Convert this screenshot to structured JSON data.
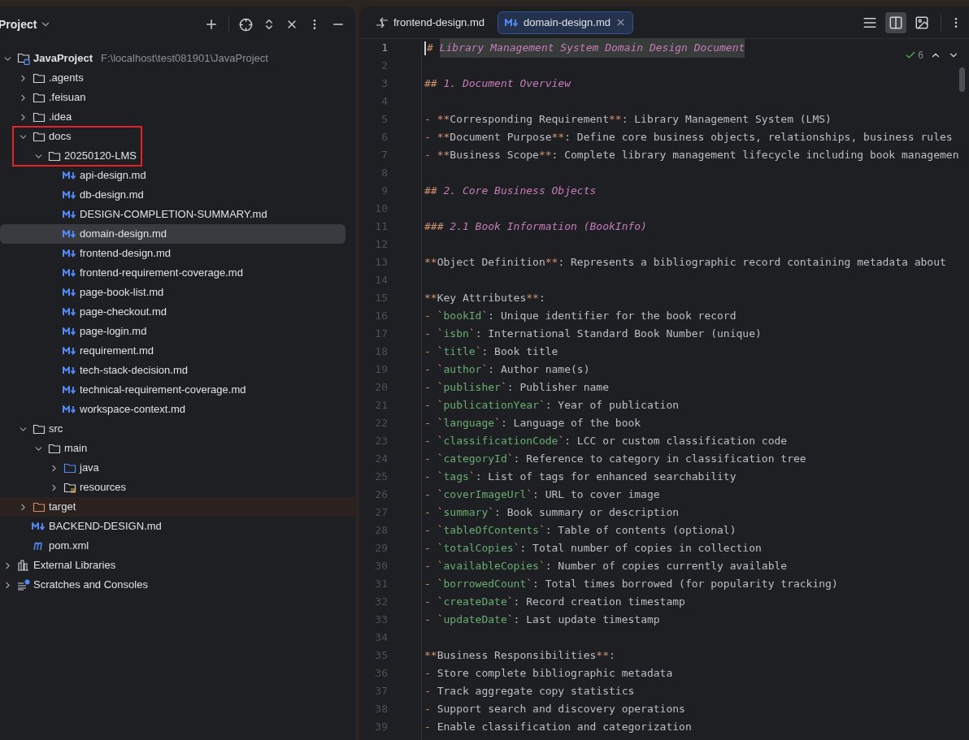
{
  "project_panel": {
    "title": "Project",
    "tree": [
      {
        "name": "JavaProject",
        "kind": "module",
        "location": "F:\\localhost\\test081901\\JavaProject",
        "expanded": true,
        "selected": false,
        "outlined": false,
        "children": [
          {
            "name": ".agents",
            "kind": "folder",
            "expanded": false,
            "selected": false,
            "outlined": false
          },
          {
            "name": ".feisuan",
            "kind": "folder",
            "expanded": false,
            "selected": false,
            "outlined": false
          },
          {
            "name": ".idea",
            "kind": "folder",
            "expanded": false,
            "selected": false,
            "outlined": false
          },
          {
            "name": "docs",
            "kind": "folder",
            "expanded": true,
            "selected": false,
            "outlined": true,
            "children": [
              {
                "name": "20250120-LMS",
                "kind": "folder",
                "expanded": true,
                "selected": false,
                "outlined": true,
                "children": [
                  {
                    "name": "api-design.md",
                    "kind": "markdown",
                    "selected": false,
                    "outlined": false
                  },
                  {
                    "name": "db-design.md",
                    "kind": "markdown",
                    "selected": false,
                    "outlined": false
                  },
                  {
                    "name": "DESIGN-COMPLETION-SUMMARY.md",
                    "kind": "markdown",
                    "selected": false,
                    "outlined": false
                  },
                  {
                    "name": "domain-design.md",
                    "kind": "markdown",
                    "selected": true,
                    "outlined": false
                  },
                  {
                    "name": "frontend-design.md",
                    "kind": "markdown",
                    "selected": false,
                    "outlined": false
                  },
                  {
                    "name": "frontend-requirement-coverage.md",
                    "kind": "markdown",
                    "selected": false,
                    "outlined": false
                  },
                  {
                    "name": "page-book-list.md",
                    "kind": "markdown",
                    "selected": false,
                    "outlined": false
                  },
                  {
                    "name": "page-checkout.md",
                    "kind": "markdown",
                    "selected": false,
                    "outlined": false
                  },
                  {
                    "name": "page-login.md",
                    "kind": "markdown",
                    "selected": false,
                    "outlined": false
                  },
                  {
                    "name": "requirement.md",
                    "kind": "markdown",
                    "selected": false,
                    "outlined": false
                  },
                  {
                    "name": "tech-stack-decision.md",
                    "kind": "markdown",
                    "selected": false,
                    "outlined": false
                  },
                  {
                    "name": "technical-requirement-coverage.md",
                    "kind": "markdown",
                    "selected": false,
                    "outlined": false
                  },
                  {
                    "name": "workspace-context.md",
                    "kind": "markdown",
                    "selected": false,
                    "outlined": false
                  }
                ]
              }
            ]
          },
          {
            "name": "src",
            "kind": "folder",
            "expanded": true,
            "selected": false,
            "outlined": false,
            "children": [
              {
                "name": "main",
                "kind": "folder",
                "expanded": true,
                "selected": false,
                "outlined": false,
                "children": [
                  {
                    "name": "java",
                    "kind": "source-folder",
                    "expanded": false,
                    "selected": false,
                    "outlined": false
                  },
                  {
                    "name": "resources",
                    "kind": "resources-folder",
                    "expanded": false,
                    "selected": false,
                    "outlined": false
                  }
                ]
              }
            ]
          },
          {
            "name": "target",
            "kind": "excluded-folder",
            "expanded": false,
            "selected": false,
            "outlined": false
          },
          {
            "name": "BACKEND-DESIGN.md",
            "kind": "markdown",
            "selected": false,
            "outlined": false
          },
          {
            "name": "pom.xml",
            "kind": "maven",
            "selected": false,
            "outlined": false
          }
        ]
      },
      {
        "name": "External Libraries",
        "kind": "libraries",
        "expanded": false,
        "selected": false,
        "outlined": false
      },
      {
        "name": "Scratches and Consoles",
        "kind": "scratches",
        "expanded": false,
        "selected": false,
        "outlined": false
      }
    ]
  },
  "editor": {
    "tabs": [
      {
        "label": "frontend-design.md",
        "kind": "diff",
        "selected": false
      },
      {
        "label": "domain-design.md",
        "kind": "markdown",
        "selected": true
      }
    ],
    "view_modes": [
      {
        "kind": "editor",
        "selected": false
      },
      {
        "kind": "split",
        "selected": true
      },
      {
        "kind": "preview",
        "selected": false
      }
    ],
    "problems_count": "6",
    "lines": [
      {
        "number": "1",
        "current": true,
        "segments": [
          {
            "kind": "mark",
            "text": "# "
          },
          {
            "kind": "heading",
            "text": "Library Management System Domain Design Document"
          }
        ]
      },
      {
        "number": "2",
        "current": false
      },
      {
        "number": "3",
        "current": false,
        "segments": [
          {
            "kind": "mark",
            "text": "## "
          },
          {
            "kind": "heading",
            "text": "1. Document Overview"
          }
        ]
      },
      {
        "number": "4",
        "current": false
      },
      {
        "number": "5",
        "current": false,
        "segments": [
          {
            "kind": "mark",
            "text": "- **"
          },
          {
            "kind": "text",
            "text": "Corresponding Requirement"
          },
          {
            "kind": "mark",
            "text": "**"
          },
          {
            "kind": "text",
            "text": ": Library Management System (LMS)"
          }
        ]
      },
      {
        "number": "6",
        "current": false,
        "segments": [
          {
            "kind": "mark",
            "text": "- **"
          },
          {
            "kind": "text",
            "text": "Document Purpose"
          },
          {
            "kind": "mark",
            "text": "**"
          },
          {
            "kind": "text",
            "text": ": Define core business objects, relationships, business rules"
          }
        ]
      },
      {
        "number": "7",
        "current": false,
        "segments": [
          {
            "kind": "mark",
            "text": "- **"
          },
          {
            "kind": "text",
            "text": "Business Scope"
          },
          {
            "kind": "mark",
            "text": "**"
          },
          {
            "kind": "text",
            "text": ": Complete library management lifecycle including book managemen"
          }
        ]
      },
      {
        "number": "8",
        "current": false
      },
      {
        "number": "9",
        "current": false,
        "segments": [
          {
            "kind": "mark",
            "text": "## "
          },
          {
            "kind": "heading",
            "text": "2. Core Business Objects"
          }
        ]
      },
      {
        "number": "10",
        "current": false
      },
      {
        "number": "11",
        "current": false,
        "segments": [
          {
            "kind": "mark",
            "text": "### "
          },
          {
            "kind": "heading",
            "text": "2.1 Book Information (BookInfo)"
          }
        ]
      },
      {
        "number": "12",
        "current": false
      },
      {
        "number": "13",
        "current": false,
        "segments": [
          {
            "kind": "mark",
            "text": "**"
          },
          {
            "kind": "text",
            "text": "Object Definition"
          },
          {
            "kind": "mark",
            "text": "**"
          },
          {
            "kind": "text",
            "text": ": Represents a bibliographic record containing metadata about"
          }
        ]
      },
      {
        "number": "14",
        "current": false
      },
      {
        "number": "15",
        "current": false,
        "segments": [
          {
            "kind": "mark",
            "text": "**"
          },
          {
            "kind": "text",
            "text": "Key Attributes"
          },
          {
            "kind": "mark",
            "text": "**"
          },
          {
            "kind": "text",
            "text": ":"
          }
        ]
      },
      {
        "number": "16",
        "current": false,
        "segments": [
          {
            "kind": "mark",
            "text": "- `"
          },
          {
            "kind": "code",
            "text": "bookId"
          },
          {
            "kind": "mark",
            "text": "`"
          },
          {
            "kind": "text",
            "text": ": Unique identifier for the book record"
          }
        ]
      },
      {
        "number": "17",
        "current": false,
        "segments": [
          {
            "kind": "mark",
            "text": "- `"
          },
          {
            "kind": "code",
            "text": "isbn"
          },
          {
            "kind": "mark",
            "text": "`"
          },
          {
            "kind": "text",
            "text": ": International Standard Book Number (unique)"
          }
        ]
      },
      {
        "number": "18",
        "current": false,
        "segments": [
          {
            "kind": "mark",
            "text": "- `"
          },
          {
            "kind": "code",
            "text": "title"
          },
          {
            "kind": "mark",
            "text": "`"
          },
          {
            "kind": "text",
            "text": ": Book title"
          }
        ]
      },
      {
        "number": "19",
        "current": false,
        "segments": [
          {
            "kind": "mark",
            "text": "- `"
          },
          {
            "kind": "code",
            "text": "author"
          },
          {
            "kind": "mark",
            "text": "`"
          },
          {
            "kind": "text",
            "text": ": Author name(s)"
          }
        ]
      },
      {
        "number": "20",
        "current": false,
        "segments": [
          {
            "kind": "mark",
            "text": "- `"
          },
          {
            "kind": "code",
            "text": "publisher"
          },
          {
            "kind": "mark",
            "text": "`"
          },
          {
            "kind": "text",
            "text": ": Publisher name"
          }
        ]
      },
      {
        "number": "21",
        "current": false,
        "segments": [
          {
            "kind": "mark",
            "text": "- `"
          },
          {
            "kind": "code",
            "text": "publicationYear"
          },
          {
            "kind": "mark",
            "text": "`"
          },
          {
            "kind": "text",
            "text": ": Year of publication"
          }
        ]
      },
      {
        "number": "22",
        "current": false,
        "segments": [
          {
            "kind": "mark",
            "text": "- `"
          },
          {
            "kind": "code",
            "text": "language"
          },
          {
            "kind": "mark",
            "text": "`"
          },
          {
            "kind": "text",
            "text": ": Language of the book"
          }
        ]
      },
      {
        "number": "23",
        "current": false,
        "segments": [
          {
            "kind": "mark",
            "text": "- `"
          },
          {
            "kind": "code",
            "text": "classificationCode"
          },
          {
            "kind": "mark",
            "text": "`"
          },
          {
            "kind": "text",
            "text": ": LCC or custom classification code"
          }
        ]
      },
      {
        "number": "24",
        "current": false,
        "segments": [
          {
            "kind": "mark",
            "text": "- `"
          },
          {
            "kind": "code",
            "text": "categoryId"
          },
          {
            "kind": "mark",
            "text": "`"
          },
          {
            "kind": "text",
            "text": ": Reference to category in classification tree"
          }
        ]
      },
      {
        "number": "25",
        "current": false,
        "segments": [
          {
            "kind": "mark",
            "text": "- `"
          },
          {
            "kind": "code",
            "text": "tags"
          },
          {
            "kind": "mark",
            "text": "`"
          },
          {
            "kind": "text",
            "text": ": List of tags for enhanced searchability"
          }
        ]
      },
      {
        "number": "26",
        "current": false,
        "segments": [
          {
            "kind": "mark",
            "text": "- `"
          },
          {
            "kind": "code",
            "text": "coverImageUrl"
          },
          {
            "kind": "mark",
            "text": "`"
          },
          {
            "kind": "text",
            "text": ": URL to cover image"
          }
        ]
      },
      {
        "number": "27",
        "current": false,
        "segments": [
          {
            "kind": "mark",
            "text": "- `"
          },
          {
            "kind": "code",
            "text": "summary"
          },
          {
            "kind": "mark",
            "text": "`"
          },
          {
            "kind": "text",
            "text": ": Book summary or description"
          }
        ]
      },
      {
        "number": "28",
        "current": false,
        "segments": [
          {
            "kind": "mark",
            "text": "- `"
          },
          {
            "kind": "code",
            "text": "tableOfContents"
          },
          {
            "kind": "mark",
            "text": "`"
          },
          {
            "kind": "text",
            "text": ": Table of contents (optional)"
          }
        ]
      },
      {
        "number": "29",
        "current": false,
        "segments": [
          {
            "kind": "mark",
            "text": "- `"
          },
          {
            "kind": "code",
            "text": "totalCopies"
          },
          {
            "kind": "mark",
            "text": "`"
          },
          {
            "kind": "text",
            "text": ": Total number of copies in collection"
          }
        ]
      },
      {
        "number": "30",
        "current": false,
        "segments": [
          {
            "kind": "mark",
            "text": "- `"
          },
          {
            "kind": "code",
            "text": "availableCopies"
          },
          {
            "kind": "mark",
            "text": "`"
          },
          {
            "kind": "text",
            "text": ": Number of copies currently available"
          }
        ]
      },
      {
        "number": "31",
        "current": false,
        "segments": [
          {
            "kind": "mark",
            "text": "- `"
          },
          {
            "kind": "code",
            "text": "borrowedCount"
          },
          {
            "kind": "mark",
            "text": "`"
          },
          {
            "kind": "text",
            "text": ": Total times borrowed (for popularity tracking)"
          }
        ]
      },
      {
        "number": "32",
        "current": false,
        "segments": [
          {
            "kind": "mark",
            "text": "- `"
          },
          {
            "kind": "code",
            "text": "createDate"
          },
          {
            "kind": "mark",
            "text": "`"
          },
          {
            "kind": "text",
            "text": ": Record creation timestamp"
          }
        ]
      },
      {
        "number": "33",
        "current": false,
        "segments": [
          {
            "kind": "mark",
            "text": "- `"
          },
          {
            "kind": "code",
            "text": "updateDate"
          },
          {
            "kind": "mark",
            "text": "`"
          },
          {
            "kind": "text",
            "text": ": Last update timestamp"
          }
        ]
      },
      {
        "number": "34",
        "current": false
      },
      {
        "number": "35",
        "current": false,
        "segments": [
          {
            "kind": "mark",
            "text": "**"
          },
          {
            "kind": "text",
            "text": "Business Responsibilities"
          },
          {
            "kind": "mark",
            "text": "**"
          },
          {
            "kind": "text",
            "text": ":"
          }
        ]
      },
      {
        "number": "36",
        "current": false,
        "segments": [
          {
            "kind": "mark",
            "text": "- "
          },
          {
            "kind": "text",
            "text": "Store complete bibliographic metadata"
          }
        ]
      },
      {
        "number": "37",
        "current": false,
        "segments": [
          {
            "kind": "mark",
            "text": "- "
          },
          {
            "kind": "text",
            "text": "Track aggregate copy statistics"
          }
        ]
      },
      {
        "number": "38",
        "current": false,
        "segments": [
          {
            "kind": "mark",
            "text": "- "
          },
          {
            "kind": "text",
            "text": "Support search and discovery operations"
          }
        ]
      },
      {
        "number": "39",
        "current": false,
        "segments": [
          {
            "kind": "mark",
            "text": "- "
          },
          {
            "kind": "text",
            "text": "Enable classification and categorization"
          }
        ]
      }
    ]
  }
}
